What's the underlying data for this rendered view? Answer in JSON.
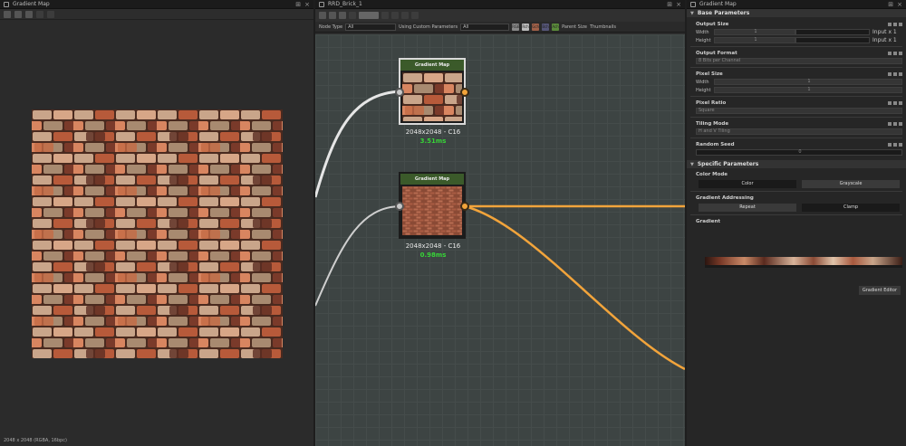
{
  "left_panel": {
    "title": "Gradient Map",
    "status": "2048 x 2048 (RGBA, 16bpc)"
  },
  "mid_panel": {
    "title": "RRD_Brick_1",
    "filter": {
      "node_type_label": "Node Type",
      "node_type_value": "All",
      "custom_params_label": "Using Custom Parameters",
      "custom_params_value": "All",
      "channels": [
        "RGB",
        "Rch",
        "Gch",
        "Bch",
        "Ach"
      ],
      "parent_size": "Parent Size",
      "thumbnails": "Thumbnails"
    },
    "nodes": [
      {
        "title": "Gradient Map",
        "info": "2048x2048 - C16",
        "time": "3.51ms"
      },
      {
        "title": "Gradient Map",
        "info": "2048x2048 - C16",
        "time": "0.98ms"
      }
    ]
  },
  "right_panel": {
    "title": "Gradient Map",
    "base_params": {
      "header": "Base Parameters",
      "output_size": "Output Size",
      "width": "Width",
      "height": "Height",
      "width_val": "1",
      "height_val": "1",
      "width_mode": "Input x 1",
      "height_mode": "Input x 1",
      "output_format": "Output Format",
      "output_format_val": "8 Bits per Channel",
      "pixel_size": "Pixel Size",
      "px_width_val": "1",
      "px_height_val": "1",
      "pixel_ratio": "Pixel Ratio",
      "pixel_ratio_val": "Square",
      "tiling_mode": "Tiling Mode",
      "tiling_mode_val": "H and V Tiling",
      "random_seed": "Random Seed",
      "random_seed_val": "0"
    },
    "specific_params": {
      "header": "Specific Parameters",
      "color_mode": "Color Mode",
      "color_btn": "Color",
      "gray_btn": "Grayscale",
      "addressing": "Gradient Addressing",
      "repeat_btn": "Repeat",
      "clamp_btn": "Clamp",
      "gradient": "Gradient",
      "editor_btn": "Gradient Editor"
    }
  },
  "colors": {
    "accent_output": "#f2a43b",
    "node_header": "#3b5a2a",
    "time_green": "#37d437"
  }
}
